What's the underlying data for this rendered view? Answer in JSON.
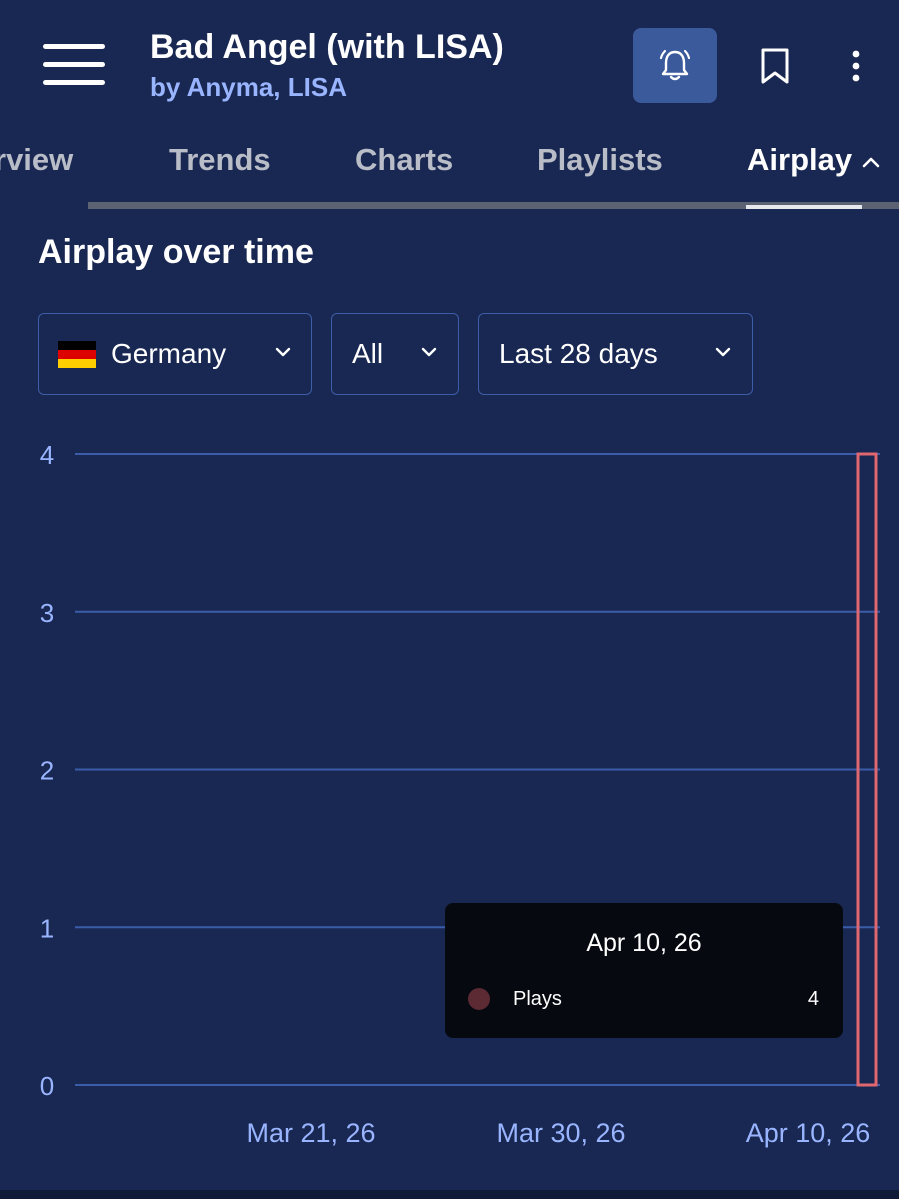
{
  "header": {
    "title": "Bad Angel (with LISA)",
    "subtitle": "by Anyma, LISA",
    "icons": [
      "menu-icon",
      "bell-icon",
      "bookmark-icon",
      "more-vertical-icon"
    ]
  },
  "tabs": [
    {
      "label": "rview"
    },
    {
      "label": "Trends"
    },
    {
      "label": "Charts"
    },
    {
      "label": "Playlists"
    },
    {
      "label": "Airplay",
      "active": true
    }
  ],
  "section": {
    "title": "Airplay over time"
  },
  "filters": {
    "country": "Germany",
    "type": "All",
    "period": "Last 28 days"
  },
  "colors": {
    "background": "#192852",
    "accent_button": "#3b5a9c",
    "bar_outline": "#e0676f",
    "grid": "#3b5ca8",
    "axis_text": "#9ab5ff"
  },
  "chart_data": {
    "type": "bar",
    "title": "Airplay over time",
    "x_tick_labels": [
      "Mar 21, 26",
      "Mar 30, 26",
      "Apr 10, 26"
    ],
    "y_ticks": [
      0,
      1,
      2,
      3,
      4
    ],
    "ylim": [
      0,
      4
    ],
    "series": [
      {
        "name": "Plays",
        "points": [
          {
            "x": "Apr 10, 26",
            "y": 4
          }
        ]
      }
    ],
    "grid": true
  },
  "tooltip": {
    "date": "Apr 10, 26",
    "series_name": "Plays",
    "value": "4"
  }
}
